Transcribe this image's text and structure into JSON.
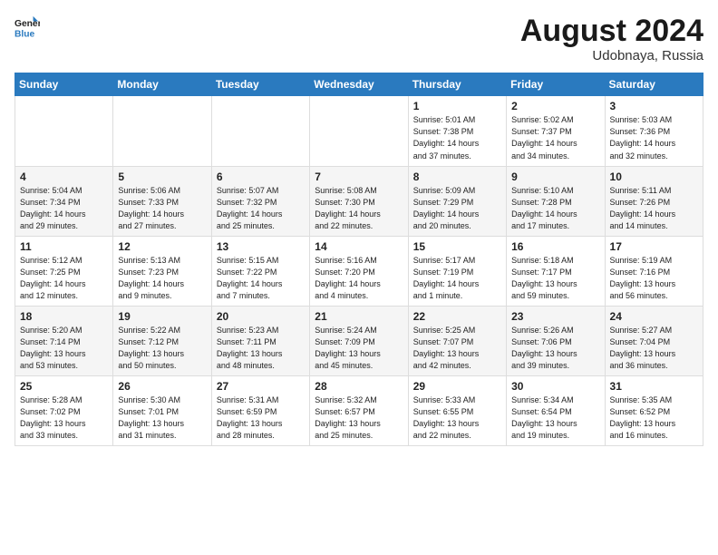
{
  "header": {
    "logo_line1": "General",
    "logo_line2": "Blue",
    "month_year": "August 2024",
    "location": "Udobnaya, Russia"
  },
  "weekdays": [
    "Sunday",
    "Monday",
    "Tuesday",
    "Wednesday",
    "Thursday",
    "Friday",
    "Saturday"
  ],
  "weeks": [
    [
      {
        "day": "",
        "info": ""
      },
      {
        "day": "",
        "info": ""
      },
      {
        "day": "",
        "info": ""
      },
      {
        "day": "",
        "info": ""
      },
      {
        "day": "1",
        "info": "Sunrise: 5:01 AM\nSunset: 7:38 PM\nDaylight: 14 hours\nand 37 minutes."
      },
      {
        "day": "2",
        "info": "Sunrise: 5:02 AM\nSunset: 7:37 PM\nDaylight: 14 hours\nand 34 minutes."
      },
      {
        "day": "3",
        "info": "Sunrise: 5:03 AM\nSunset: 7:36 PM\nDaylight: 14 hours\nand 32 minutes."
      }
    ],
    [
      {
        "day": "4",
        "info": "Sunrise: 5:04 AM\nSunset: 7:34 PM\nDaylight: 14 hours\nand 29 minutes."
      },
      {
        "day": "5",
        "info": "Sunrise: 5:06 AM\nSunset: 7:33 PM\nDaylight: 14 hours\nand 27 minutes."
      },
      {
        "day": "6",
        "info": "Sunrise: 5:07 AM\nSunset: 7:32 PM\nDaylight: 14 hours\nand 25 minutes."
      },
      {
        "day": "7",
        "info": "Sunrise: 5:08 AM\nSunset: 7:30 PM\nDaylight: 14 hours\nand 22 minutes."
      },
      {
        "day": "8",
        "info": "Sunrise: 5:09 AM\nSunset: 7:29 PM\nDaylight: 14 hours\nand 20 minutes."
      },
      {
        "day": "9",
        "info": "Sunrise: 5:10 AM\nSunset: 7:28 PM\nDaylight: 14 hours\nand 17 minutes."
      },
      {
        "day": "10",
        "info": "Sunrise: 5:11 AM\nSunset: 7:26 PM\nDaylight: 14 hours\nand 14 minutes."
      }
    ],
    [
      {
        "day": "11",
        "info": "Sunrise: 5:12 AM\nSunset: 7:25 PM\nDaylight: 14 hours\nand 12 minutes."
      },
      {
        "day": "12",
        "info": "Sunrise: 5:13 AM\nSunset: 7:23 PM\nDaylight: 14 hours\nand 9 minutes."
      },
      {
        "day": "13",
        "info": "Sunrise: 5:15 AM\nSunset: 7:22 PM\nDaylight: 14 hours\nand 7 minutes."
      },
      {
        "day": "14",
        "info": "Sunrise: 5:16 AM\nSunset: 7:20 PM\nDaylight: 14 hours\nand 4 minutes."
      },
      {
        "day": "15",
        "info": "Sunrise: 5:17 AM\nSunset: 7:19 PM\nDaylight: 14 hours\nand 1 minute."
      },
      {
        "day": "16",
        "info": "Sunrise: 5:18 AM\nSunset: 7:17 PM\nDaylight: 13 hours\nand 59 minutes."
      },
      {
        "day": "17",
        "info": "Sunrise: 5:19 AM\nSunset: 7:16 PM\nDaylight: 13 hours\nand 56 minutes."
      }
    ],
    [
      {
        "day": "18",
        "info": "Sunrise: 5:20 AM\nSunset: 7:14 PM\nDaylight: 13 hours\nand 53 minutes."
      },
      {
        "day": "19",
        "info": "Sunrise: 5:22 AM\nSunset: 7:12 PM\nDaylight: 13 hours\nand 50 minutes."
      },
      {
        "day": "20",
        "info": "Sunrise: 5:23 AM\nSunset: 7:11 PM\nDaylight: 13 hours\nand 48 minutes."
      },
      {
        "day": "21",
        "info": "Sunrise: 5:24 AM\nSunset: 7:09 PM\nDaylight: 13 hours\nand 45 minutes."
      },
      {
        "day": "22",
        "info": "Sunrise: 5:25 AM\nSunset: 7:07 PM\nDaylight: 13 hours\nand 42 minutes."
      },
      {
        "day": "23",
        "info": "Sunrise: 5:26 AM\nSunset: 7:06 PM\nDaylight: 13 hours\nand 39 minutes."
      },
      {
        "day": "24",
        "info": "Sunrise: 5:27 AM\nSunset: 7:04 PM\nDaylight: 13 hours\nand 36 minutes."
      }
    ],
    [
      {
        "day": "25",
        "info": "Sunrise: 5:28 AM\nSunset: 7:02 PM\nDaylight: 13 hours\nand 33 minutes."
      },
      {
        "day": "26",
        "info": "Sunrise: 5:30 AM\nSunset: 7:01 PM\nDaylight: 13 hours\nand 31 minutes."
      },
      {
        "day": "27",
        "info": "Sunrise: 5:31 AM\nSunset: 6:59 PM\nDaylight: 13 hours\nand 28 minutes."
      },
      {
        "day": "28",
        "info": "Sunrise: 5:32 AM\nSunset: 6:57 PM\nDaylight: 13 hours\nand 25 minutes."
      },
      {
        "day": "29",
        "info": "Sunrise: 5:33 AM\nSunset: 6:55 PM\nDaylight: 13 hours\nand 22 minutes."
      },
      {
        "day": "30",
        "info": "Sunrise: 5:34 AM\nSunset: 6:54 PM\nDaylight: 13 hours\nand 19 minutes."
      },
      {
        "day": "31",
        "info": "Sunrise: 5:35 AM\nSunset: 6:52 PM\nDaylight: 13 hours\nand 16 minutes."
      }
    ]
  ]
}
